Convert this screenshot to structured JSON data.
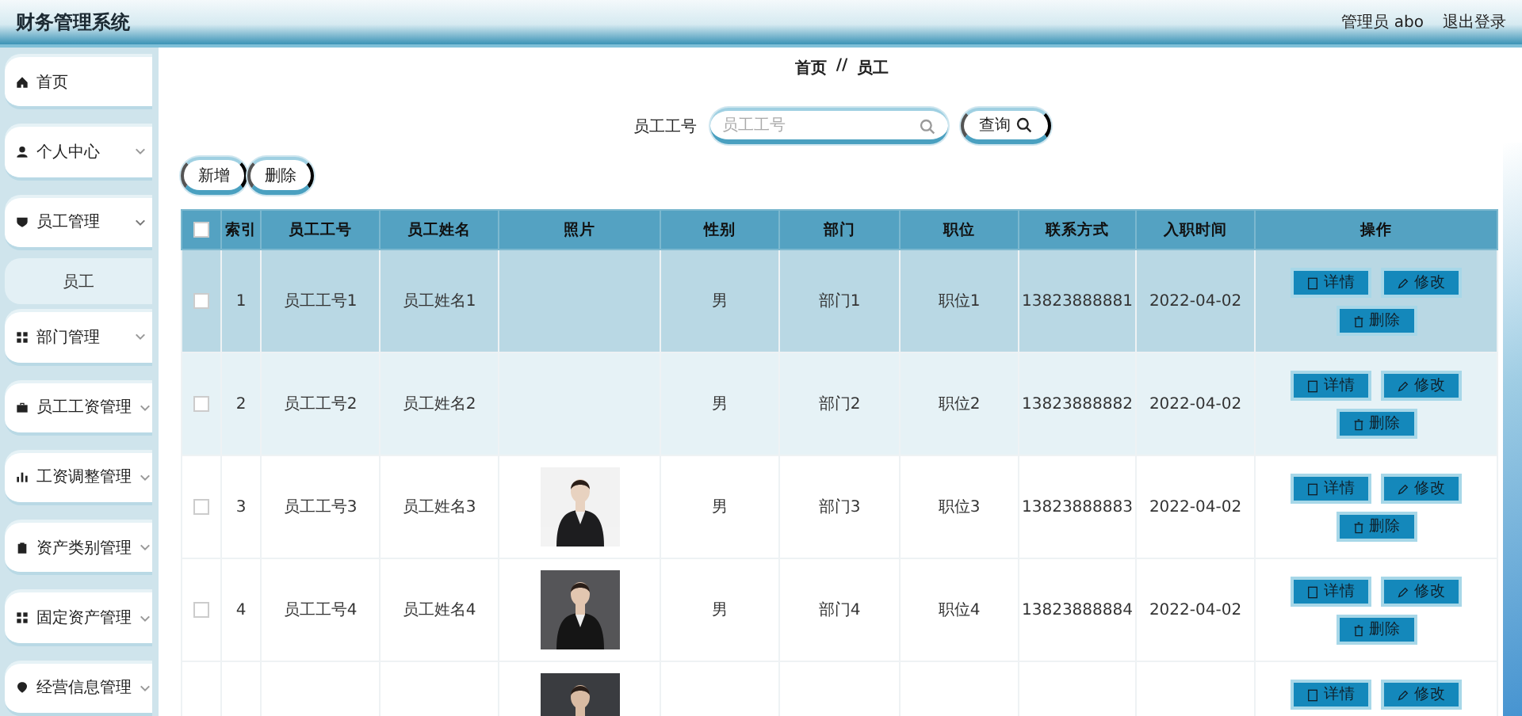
{
  "header": {
    "title": "财务管理系统",
    "user": "管理员 abo",
    "logout": "退出登录"
  },
  "sidebar": {
    "items": [
      {
        "label": "首页",
        "kind": "link"
      },
      {
        "label": "个人中心",
        "kind": "menu",
        "expanded": false
      },
      {
        "label": "员工管理",
        "kind": "menu",
        "expanded": true,
        "children": [
          {
            "label": "员工",
            "selected": true
          }
        ]
      },
      {
        "label": "部门管理",
        "kind": "menu",
        "expanded": false
      },
      {
        "label": "员工工资管理",
        "kind": "menu",
        "expanded": false
      },
      {
        "label": "工资调整管理",
        "kind": "menu",
        "expanded": false
      },
      {
        "label": "资产类别管理",
        "kind": "menu",
        "expanded": false
      },
      {
        "label": "固定资产管理",
        "kind": "menu",
        "expanded": false
      },
      {
        "label": "经营信息管理",
        "kind": "menu",
        "expanded": false
      }
    ]
  },
  "breadcrumb": {
    "items": [
      "首页",
      "员工"
    ],
    "separator": "//"
  },
  "search": {
    "label": "员工工号",
    "placeholder": "员工工号",
    "button": "查询"
  },
  "toolbar": [
    "新增",
    "删除"
  ],
  "table": {
    "header_checked": false,
    "columns": [
      "索引",
      "员工工号",
      "员工姓名",
      "照片",
      "性别",
      "部门",
      "职位",
      "联系方式",
      "入职时间",
      "操作"
    ],
    "rows": [
      {
        "checked": false,
        "selected": true,
        "hovered": false,
        "cells": [
          "1",
          "员工工号1",
          "员工姓名1",
          "",
          "男",
          "部门1",
          "职位1",
          "13823888881",
          "2022-04-02"
        ],
        "actions": [
          {
            "label": "详情",
            "kind": "detail"
          },
          {
            "label": "修改",
            "kind": "edit"
          },
          {
            "label": "删除",
            "kind": "delete"
          }
        ]
      },
      {
        "checked": false,
        "selected": false,
        "hovered": true,
        "cells": [
          "2",
          "员工工号2",
          "员工姓名2",
          "",
          "男",
          "部门2",
          "职位2",
          "13823888882",
          "2022-04-02"
        ],
        "actions": [
          {
            "label": "详情",
            "kind": "detail"
          },
          {
            "label": "修改",
            "kind": "edit"
          },
          {
            "label": "删除",
            "kind": "delete"
          }
        ]
      },
      {
        "checked": false,
        "selected": false,
        "hovered": false,
        "photo": {
          "kind": "picture"
        },
        "cells": [
          "3",
          "员工工号3",
          "员工姓名3",
          "",
          "男",
          "部门3",
          "职位3",
          "13823888883",
          "2022-04-02"
        ],
        "actions": [
          {
            "label": "详情",
            "kind": "detail"
          },
          {
            "label": "修改",
            "kind": "edit"
          },
          {
            "label": "删除",
            "kind": "delete"
          }
        ]
      },
      {
        "checked": false,
        "selected": false,
        "hovered": false,
        "photo": {
          "kind": "picture"
        },
        "cells": [
          "4",
          "员工工号4",
          "员工姓名4",
          "",
          "男",
          "部门4",
          "职位4",
          "13823888884",
          "2022-04-02"
        ],
        "actions": [
          {
            "label": "详情",
            "kind": "detail"
          },
          {
            "label": "修改",
            "kind": "edit"
          },
          {
            "label": "删除",
            "kind": "delete"
          }
        ]
      },
      {
        "selected": false,
        "hovered": false,
        "photo": {
          "kind": "picture"
        },
        "cells": [],
        "actions": [
          {
            "label": "详情",
            "kind": "detail"
          },
          {
            "label": "修改",
            "kind": "edit"
          }
        ]
      }
    ]
  }
}
